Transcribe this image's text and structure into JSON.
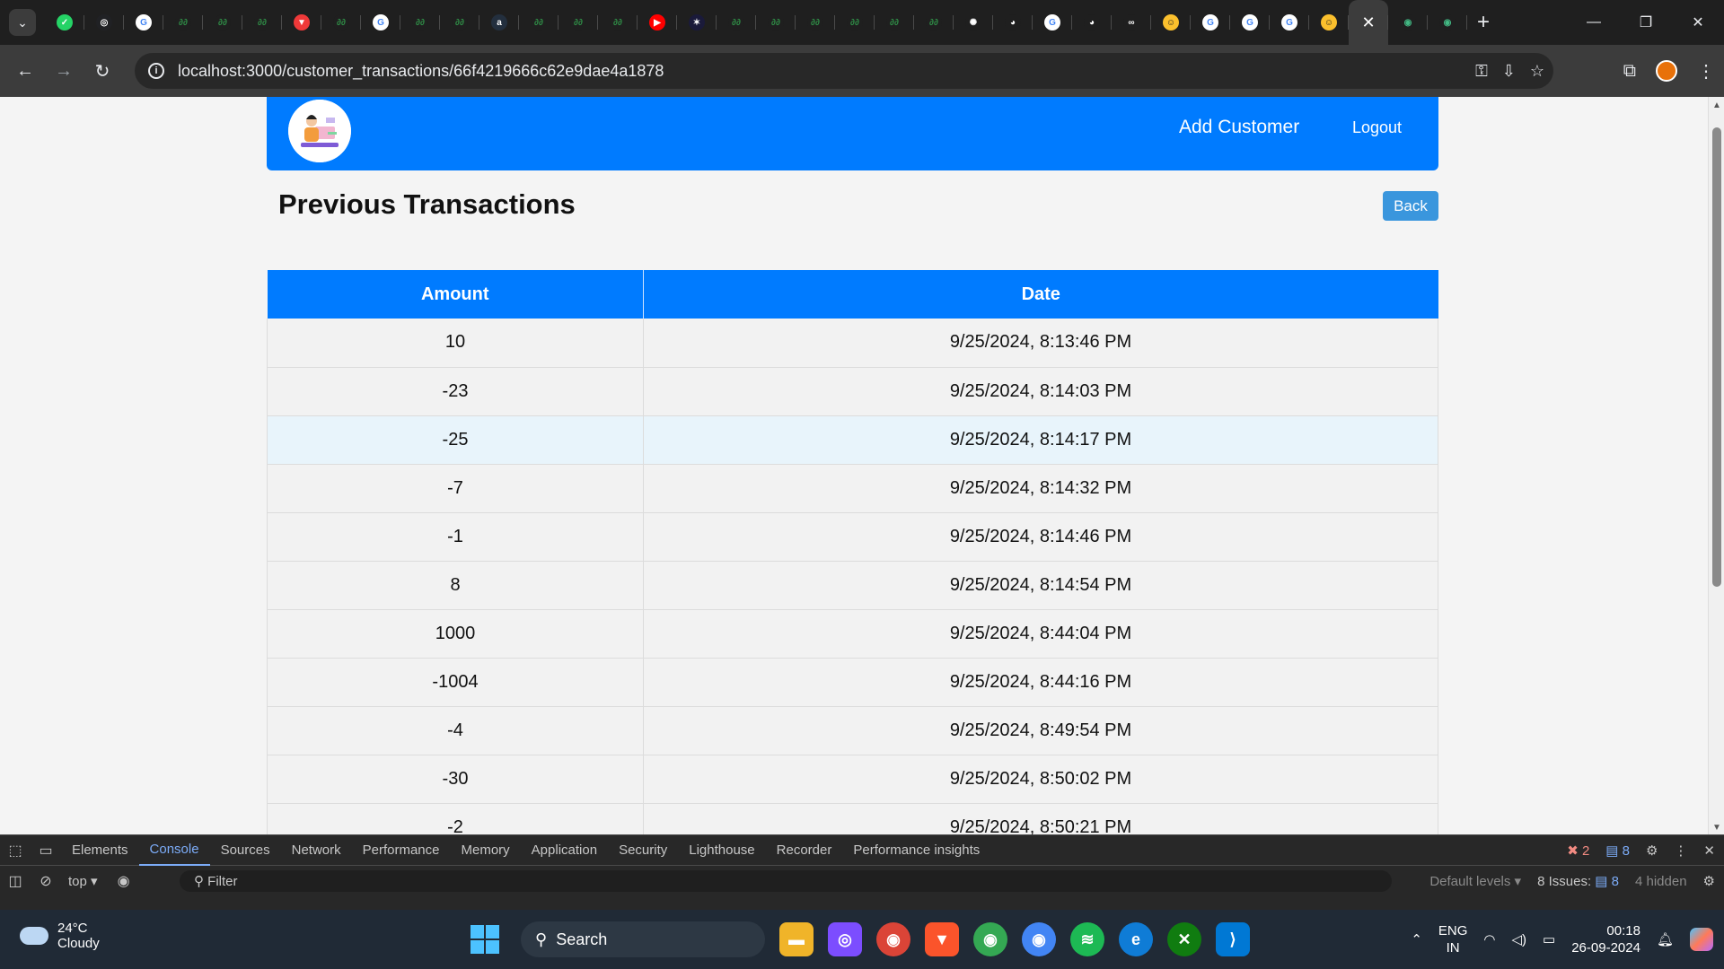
{
  "browser": {
    "url": "localhost:3000/customer_transactions/66f4219666c62e9dae4a1878",
    "tab_count_icons": [
      "whatsapp",
      "chrome-circle",
      "google",
      "gfg",
      "gfg",
      "gfg",
      "vivaldi",
      "gfg",
      "google",
      "gfg",
      "gfg",
      "aws",
      "gfg",
      "gfg",
      "gfg",
      "youtube",
      "dark-app",
      "gfg",
      "gfg",
      "gfg",
      "gfg",
      "gfg",
      "gfg",
      "openai",
      "github",
      "google",
      "github",
      "infinity",
      "smiley",
      "google",
      "google",
      "google",
      "smiley"
    ]
  },
  "navbar": {
    "add_customer": "Add Customer",
    "logout": "Logout"
  },
  "page": {
    "title": "Previous Transactions",
    "back": "Back"
  },
  "table": {
    "headers": [
      "Amount",
      "Date"
    ],
    "rows": [
      {
        "amount": "10",
        "date": "9/25/2024, 8:13:46 PM"
      },
      {
        "amount": "-23",
        "date": "9/25/2024, 8:14:03 PM"
      },
      {
        "amount": "-25",
        "date": "9/25/2024, 8:14:17 PM"
      },
      {
        "amount": "-7",
        "date": "9/25/2024, 8:14:32 PM"
      },
      {
        "amount": "-1",
        "date": "9/25/2024, 8:14:46 PM"
      },
      {
        "amount": "8",
        "date": "9/25/2024, 8:14:54 PM"
      },
      {
        "amount": "1000",
        "date": "9/25/2024, 8:44:04 PM"
      },
      {
        "amount": "-1004",
        "date": "9/25/2024, 8:44:16 PM"
      },
      {
        "amount": "-4",
        "date": "9/25/2024, 8:49:54 PM"
      },
      {
        "amount": "-30",
        "date": "9/25/2024, 8:50:02 PM"
      },
      {
        "amount": "-2",
        "date": "9/25/2024, 8:50:21 PM"
      }
    ]
  },
  "devtools": {
    "tabs": [
      "Elements",
      "Console",
      "Sources",
      "Network",
      "Performance",
      "Memory",
      "Application",
      "Security",
      "Lighthouse",
      "Recorder",
      "Performance insights"
    ],
    "active_tab": "Console",
    "errors": "2",
    "messages": "8",
    "context": "top",
    "filter_placeholder": "Filter",
    "levels": "Default levels",
    "issues_label": "8 Issues:",
    "issues_count": "8",
    "hidden": "4 hidden"
  },
  "taskbar": {
    "temperature": "24°C",
    "weather": "Cloudy",
    "search": "Search",
    "lang1": "ENG",
    "lang2": "IN",
    "time": "00:18",
    "date": "26-09-2024"
  },
  "colors": {
    "primary": "#007bff",
    "back_button": "#3a96dd",
    "page_bg": "#f4f4f4"
  }
}
